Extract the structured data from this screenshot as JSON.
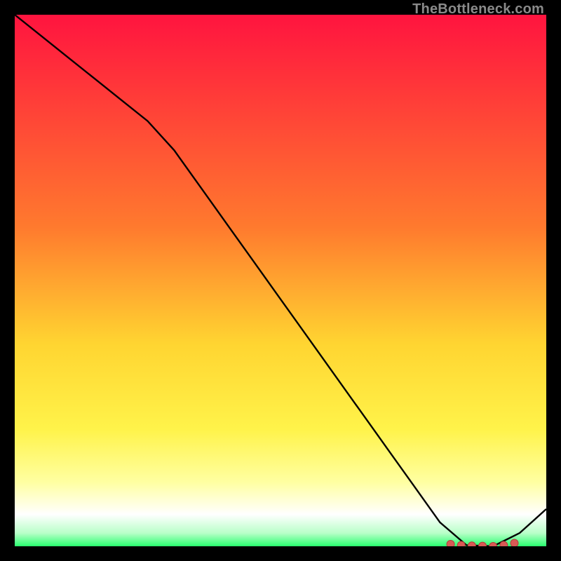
{
  "watermark": "TheBottleneck.com",
  "colors": {
    "black": "#000000",
    "curve": "#000000",
    "marker_fill": "#d85a56",
    "marker_stroke": "#b23c38",
    "grad_top": "#ff143f",
    "grad_mid1": "#ff7a2e",
    "grad_mid2": "#ffd531",
    "grad_yellow": "#fff34a",
    "grad_pale": "#ffffa2",
    "grad_white": "#ffffff",
    "grad_mint": "#b9ffc9",
    "grad_green": "#29ff6f"
  },
  "chart_data": {
    "type": "line",
    "title": "",
    "xlabel": "",
    "ylabel": "",
    "xlim": [
      0,
      100
    ],
    "ylim": [
      0,
      100
    ],
    "x": [
      0,
      5,
      10,
      15,
      20,
      25,
      30,
      35,
      40,
      45,
      50,
      55,
      60,
      65,
      70,
      75,
      80,
      85,
      90,
      95,
      100
    ],
    "series": [
      {
        "name": "bottleneck-curve",
        "values": [
          100,
          96,
          92,
          88,
          84,
          80,
          74.5,
          67.5,
          60.5,
          53.5,
          46.5,
          39.5,
          32.5,
          25.5,
          18.5,
          11.5,
          4.5,
          0.2,
          0,
          2.5,
          7
        ]
      }
    ],
    "markers": {
      "name": "highlight-region",
      "x": [
        82,
        84,
        86,
        88,
        90,
        92,
        94
      ],
      "y": [
        0.4,
        0.2,
        0.1,
        0.05,
        0,
        0.2,
        0.6
      ]
    },
    "gradient_stops": [
      {
        "pos": 0.0,
        "color_key": "grad_top"
      },
      {
        "pos": 0.4,
        "color_key": "grad_mid1"
      },
      {
        "pos": 0.62,
        "color_key": "grad_mid2"
      },
      {
        "pos": 0.78,
        "color_key": "grad_yellow"
      },
      {
        "pos": 0.88,
        "color_key": "grad_pale"
      },
      {
        "pos": 0.94,
        "color_key": "grad_white"
      },
      {
        "pos": 0.975,
        "color_key": "grad_mint"
      },
      {
        "pos": 1.0,
        "color_key": "grad_green"
      }
    ]
  }
}
